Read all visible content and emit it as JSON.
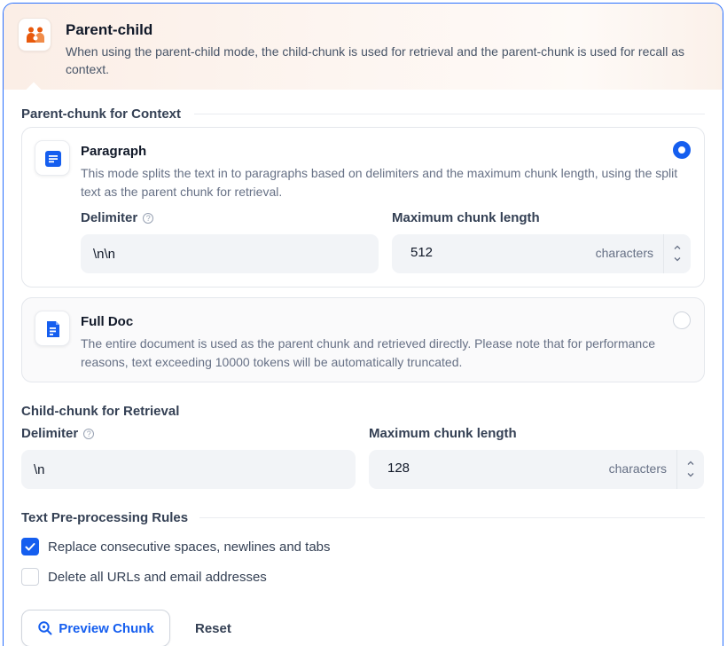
{
  "header": {
    "title": "Parent-child",
    "description": "When using the parent-child mode, the child-chunk is used for retrieval and the parent-chunk is used for recall as context.",
    "icon": "parent-child-icon",
    "accent": "#e8590c"
  },
  "parent_section": {
    "label": "Parent-chunk for Context",
    "options": [
      {
        "title": "Paragraph",
        "description": "This mode splits the text in to paragraphs based on delimiters and the maximum chunk length, using the split text as the parent chunk for retrieval.",
        "selected": true,
        "delimiter_label": "Delimiter",
        "delimiter_value": "\\n\\n",
        "max_length_label": "Maximum chunk length",
        "max_length_value": "512",
        "unit": "characters"
      },
      {
        "title": "Full Doc",
        "description": "The entire document is used as the parent chunk and retrieved directly. Please note that for performance reasons, text exceeding 10000 tokens will be automatically truncated.",
        "selected": false
      }
    ]
  },
  "child_section": {
    "label": "Child-chunk for Retrieval",
    "delimiter_label": "Delimiter",
    "delimiter_value": "\\n",
    "max_length_label": "Maximum chunk length",
    "max_length_value": "128",
    "unit": "characters"
  },
  "preprocessing": {
    "label": "Text Pre-processing Rules",
    "rules": [
      {
        "label": "Replace consecutive spaces, newlines and tabs",
        "checked": true
      },
      {
        "label": "Delete all URLs and email addresses",
        "checked": false
      }
    ]
  },
  "actions": {
    "preview_label": "Preview Chunk",
    "reset_label": "Reset"
  },
  "colors": {
    "primary": "#155eef",
    "border_active": "#2970ff"
  }
}
